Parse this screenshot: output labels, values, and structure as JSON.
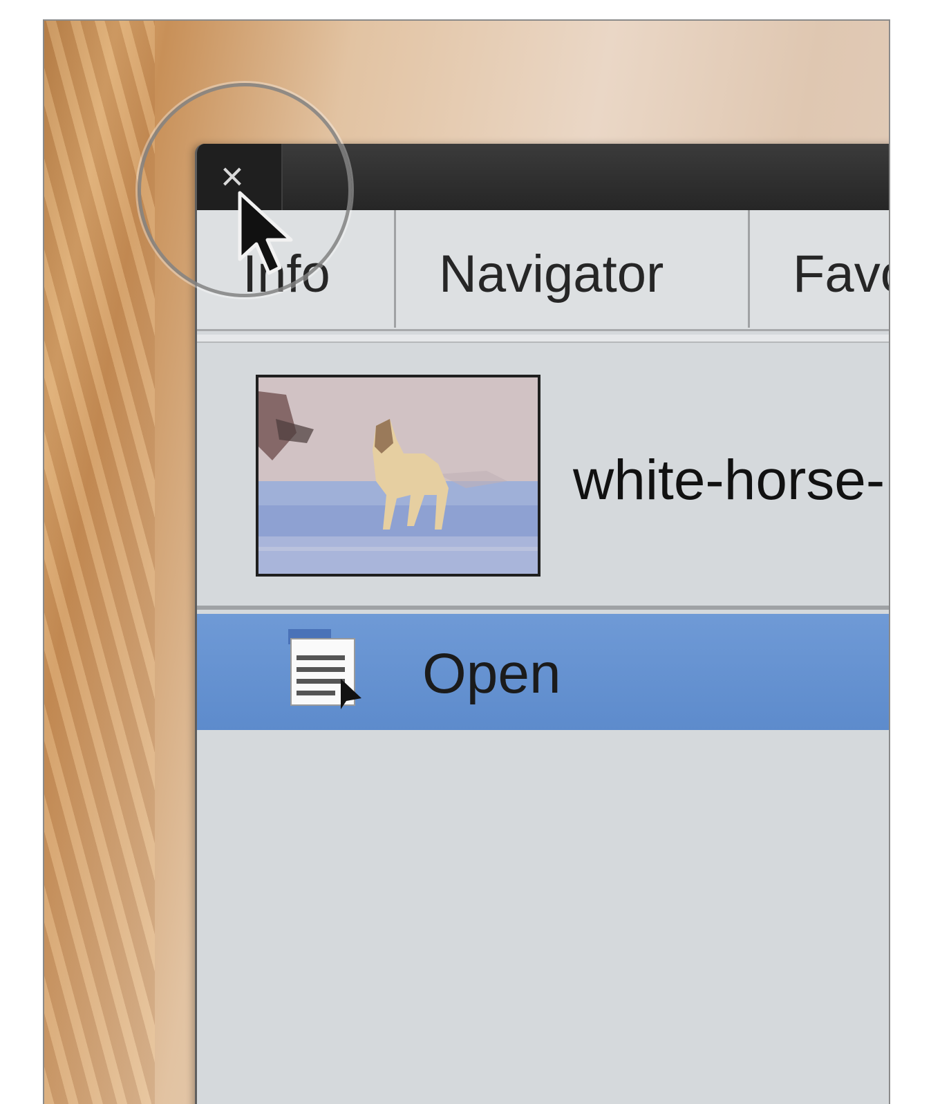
{
  "panel": {
    "close_symbol": "×",
    "tabs": [
      {
        "label": "Info"
      },
      {
        "label": "Navigator"
      },
      {
        "label": "Favor"
      }
    ],
    "file": {
      "name": "white-horse-"
    },
    "actions": [
      {
        "label": "Open",
        "icon": "document-open-icon"
      }
    ]
  },
  "colors": {
    "titlebar": "#2c2c2c",
    "panel_bg": "#d5d9dc",
    "selection": "#6592d0"
  }
}
